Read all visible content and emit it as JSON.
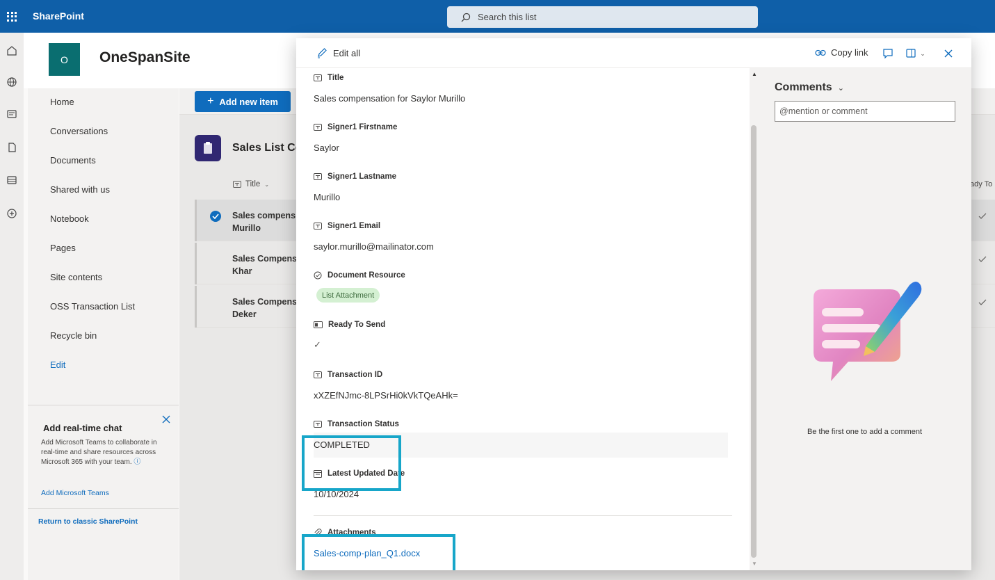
{
  "suite": {
    "app_name": "SharePoint",
    "search_placeholder": "Search this list"
  },
  "site": {
    "logo_letter": "O",
    "name": "OneSpanSite"
  },
  "nav": {
    "items": [
      "Home",
      "Conversations",
      "Documents",
      "Shared with us",
      "Notebook",
      "Pages",
      "Site contents",
      "OSS Transaction List",
      "Recycle bin"
    ],
    "edit_label": "Edit"
  },
  "chat_card": {
    "title": "Add real-time chat",
    "description": "Add Microsoft Teams to collaborate in real-time and share resources across Microsoft 365 with your team.",
    "link": "Add Microsoft Teams"
  },
  "classic_link": "Return to classic SharePoint",
  "list": {
    "add_button": "Add new item",
    "title": "Sales List Co",
    "column_title": "Title",
    "column_right": "ady To",
    "rows": [
      {
        "text": "Sales compens Murillo",
        "selected": true
      },
      {
        "text": "Sales Compens Khar",
        "selected": false
      },
      {
        "text": "Sales Compens Deker",
        "selected": false
      }
    ]
  },
  "panel": {
    "edit_all": "Edit all",
    "copy_link": "Copy link",
    "fields": [
      {
        "label": "Title",
        "value": "Sales compensation for Saylor Murillo",
        "icon": "text-field-icon"
      },
      {
        "label": "Signer1 Firstname",
        "value": "Saylor",
        "icon": "text-field-icon"
      },
      {
        "label": "Signer1 Lastname",
        "value": "Murillo",
        "icon": "text-field-icon"
      },
      {
        "label": "Signer1 Email",
        "value": "saylor.murillo@mailinator.com",
        "icon": "text-field-icon"
      },
      {
        "label": "Document Resource",
        "value": "List Attachment",
        "icon": "choice-icon"
      },
      {
        "label": "Ready To Send",
        "value": "✓",
        "icon": "yes-no-icon"
      },
      {
        "label": "Transaction ID",
        "value": "xXZEfNJmc-8LPSrHi0kVkTQeAHk=",
        "icon": "text-field-icon"
      },
      {
        "label": "Transaction Status",
        "value": "COMPLETED",
        "icon": "text-field-icon"
      },
      {
        "label": "Latest Updated Date",
        "value": "10/10/2024",
        "icon": "calendar-icon"
      },
      {
        "label": "Attachments",
        "value": "Sales-comp-plan_Q1.docx",
        "icon": "paperclip-icon"
      }
    ],
    "comments": {
      "title": "Comments",
      "placeholder": "@mention or comment",
      "empty_text": "Be the first one to add a comment"
    }
  },
  "colors": {
    "suite_bar": "#0f5fa8",
    "accent": "#0f6cbd",
    "highlight_box": "#17a6c9",
    "site_logo": "#0a6e70",
    "list_icon": "#302772"
  }
}
